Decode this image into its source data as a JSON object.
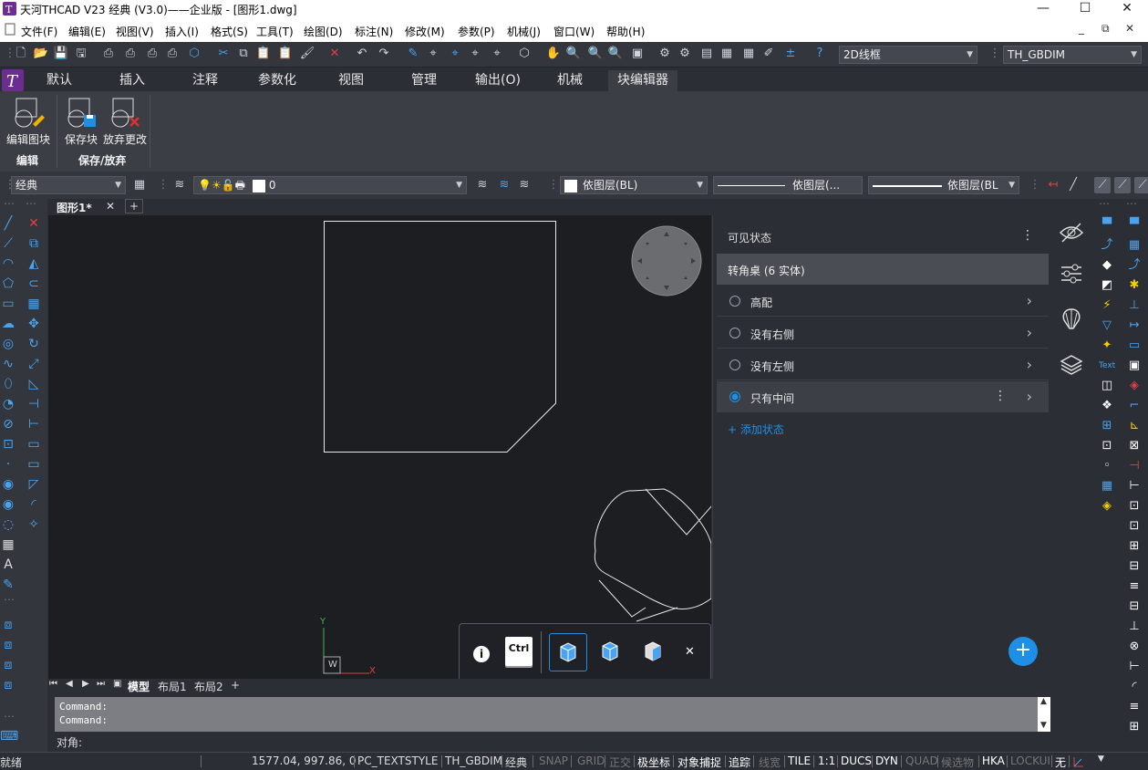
{
  "window": {
    "title": "天河THCAD V23 经典 (V3.0)——企业版 - [图形1.dwg]",
    "min": "—",
    "max": "☐",
    "close": "✕"
  },
  "menu": {
    "items": [
      "文件(F)",
      "编辑(E)",
      "视图(V)",
      "插入(I)",
      "格式(S)",
      "工具(T)",
      "绘图(D)",
      "标注(N)",
      "修改(M)",
      "参数(P)",
      "机械(J)",
      "窗口(W)",
      "帮助(H)"
    ],
    "mdi_min": "_",
    "mdi_restore": "⧉",
    "mdi_close": "✕"
  },
  "toolbar": {
    "visual_style": "2D线框",
    "dim_style": "TH_GBDIM"
  },
  "ribbon": {
    "tabs": [
      "默认",
      "插入",
      "注释",
      "参数化",
      "视图",
      "管理",
      "输出(O)",
      "机械",
      "块编辑器"
    ],
    "active_tab": "块编辑器",
    "buttons": {
      "edit_block": "编辑图块",
      "save_block": "保存块",
      "discard": "放弃更改"
    },
    "panels": {
      "edit": "编辑",
      "save_discard": "保存/放弃"
    }
  },
  "layerbar": {
    "workspace": "经典",
    "layer": "0",
    "color": "依图层(BL)",
    "linetype": "依图层(...",
    "lineweight": "依图层(BL"
  },
  "doc_tabs": {
    "active": "图形1*",
    "close": "✕",
    "add": "+"
  },
  "visibility_palette": {
    "header": "可见状态",
    "menu_glyph": "⋮",
    "block_title": "转角桌 (6 实体)",
    "states": [
      {
        "label": "高配",
        "selected": false
      },
      {
        "label": "没有右侧",
        "selected": false
      },
      {
        "label": "没有左侧",
        "selected": false
      },
      {
        "label": "只有中间",
        "selected": true
      }
    ],
    "add_state": "+ 添加状态",
    "fab": "+"
  },
  "floating_bar": {
    "info": "i",
    "ctrl": "Ctrl",
    "close": "✕"
  },
  "ucs": {
    "x": "X",
    "y": "Y",
    "w": "W"
  },
  "layout_tabs": {
    "model": "模型",
    "layout1": "布局1",
    "layout2": "布局2",
    "add": "+"
  },
  "command": {
    "lines": [
      "Command:",
      "Command:"
    ],
    "prompt": "对角:"
  },
  "status": {
    "ready": "就绪",
    "coords": "1577.04, 997.86, 0",
    "text_style": "PC_TEXTSTYLE",
    "dim_style": "TH_GBDIM",
    "workspace": "经典",
    "toggles": [
      {
        "label": "SNAP",
        "on": false
      },
      {
        "label": "GRID",
        "on": false
      },
      {
        "label": "正交",
        "on": false
      },
      {
        "label": "极坐标",
        "on": true
      },
      {
        "label": "对象捕捉",
        "on": true
      },
      {
        "label": "追踪",
        "on": true
      },
      {
        "label": "线宽",
        "on": false
      },
      {
        "label": "TILE",
        "on": true
      },
      {
        "label": "1:1",
        "on": true
      },
      {
        "label": "DUCS",
        "on": true
      },
      {
        "label": "DYN",
        "on": true
      },
      {
        "label": "QUAD",
        "on": false
      },
      {
        "label": "候选物",
        "on": false
      },
      {
        "label": "HKA",
        "on": true
      },
      {
        "label": "LOCKUI",
        "on": false
      },
      {
        "label": "无",
        "on": true
      }
    ]
  },
  "colors": {
    "accent": "#1e8fe6",
    "canvas": "#1c1e22",
    "panel": "#2b2e35"
  }
}
